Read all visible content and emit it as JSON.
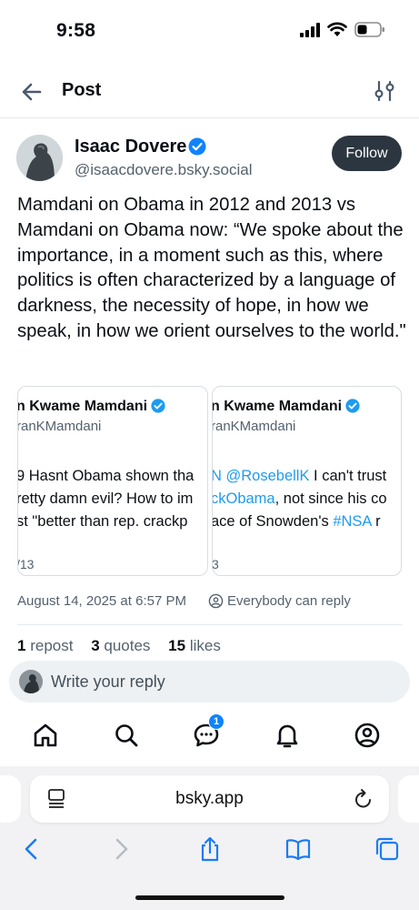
{
  "status_bar": {
    "time": "9:58"
  },
  "header": {
    "title": "Post",
    "back_icon": "arrow-left-icon",
    "filter_icon": "sliders-icon"
  },
  "post": {
    "author_name": "Isaac Dovere",
    "author_handle": "@isaacdovere.bsky.social",
    "follow_label": "Follow",
    "text": "Mamdani on Obama in 2012 and 2013 vs Mamdani on Obama now: “We spoke about the importance, in a moment such as this, where politics is often characterized by a language of darkness, the necessity of hope, in how we speak, in how we orient ourselves to the world.\"",
    "images": [
      {
        "name": "n Kwame Mamdani",
        "handle": "ranKMamdani",
        "lines": [
          "9 Hasnt Obama shown tha",
          "retty damn evil? How to im",
          "st \"better than rep. crackp"
        ],
        "footer": "/13"
      },
      {
        "name": "n Kwame Mamdani",
        "handle": "ranKMamdani",
        "line1_link": "N @RosebellK",
        "line1_rest": " I can't trust",
        "line2_link": "ckObama",
        "line2_rest": ", not since his co",
        "line3_pre": "ace of Snowden's ",
        "line3_link": "#NSA",
        "line3_post": " r",
        "footer": "3"
      }
    ],
    "timestamp": "August 14, 2025 at 6:57 PM",
    "reply_setting": "Everybody can reply",
    "stats": {
      "reposts_count": "1",
      "reposts_label": "repost",
      "quotes_count": "3",
      "quotes_label": "quotes",
      "likes_count": "15",
      "likes_label": "likes"
    }
  },
  "reply_bar": {
    "placeholder": "Write your reply"
  },
  "tabbar": {
    "items": [
      "home-icon",
      "search-icon",
      "chat-icon",
      "bell-icon",
      "profile-icon"
    ],
    "chat_badge": "1"
  },
  "browser": {
    "url": "bsky.app",
    "nav_icons": [
      "back-icon",
      "forward-icon",
      "share-icon",
      "bookmarks-icon",
      "tabs-icon"
    ]
  },
  "colors": {
    "accent": "#1d9bf0",
    "follow_bg": "#2b3640",
    "badge": "#1083fe",
    "browser_tint": "#1a7cf5"
  }
}
